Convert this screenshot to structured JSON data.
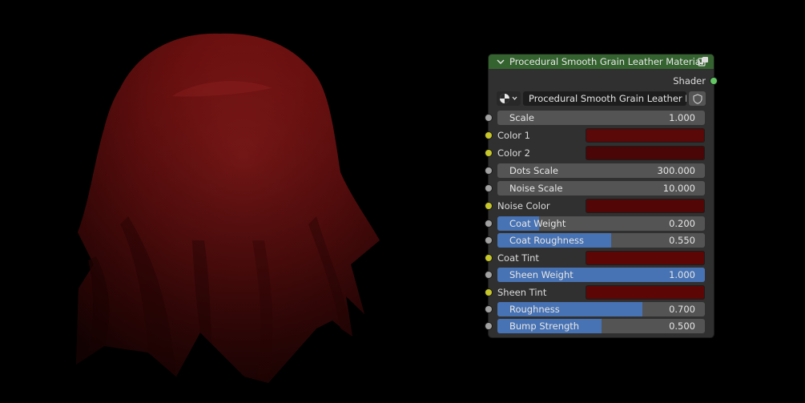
{
  "node": {
    "title": "Procedural Smooth Grain Leather Material",
    "output_label": "Shader",
    "selector": {
      "icon": "material-sphere-icon",
      "name": "Procedural Smooth Grain Leather M..."
    }
  },
  "inputs": {
    "scale": {
      "label": "Scale",
      "value": "1.000"
    },
    "color1": {
      "label": "Color 1",
      "color": "#5a0808"
    },
    "color2": {
      "label": "Color 2",
      "color": "#4a0606"
    },
    "dots_scale": {
      "label": "Dots Scale",
      "value": "300.000"
    },
    "noise_scale": {
      "label": "Noise Scale",
      "value": "10.000"
    },
    "noise_color": {
      "label": "Noise Color",
      "color": "#530606"
    },
    "coat_weight": {
      "label": "Coat Weight",
      "value": "0.200",
      "fill": 0.2
    },
    "coat_roughness": {
      "label": "Coat Roughness",
      "value": "0.550",
      "fill": 0.55
    },
    "coat_tint": {
      "label": "Coat Tint",
      "color": "#5d0606"
    },
    "sheen_weight": {
      "label": "Sheen Weight",
      "value": "1.000",
      "fill": 1.0
    },
    "sheen_tint": {
      "label": "Sheen Tint",
      "color": "#5d0606"
    },
    "roughness": {
      "label": "Roughness",
      "value": "0.700",
      "fill": 0.7
    },
    "bump_strength": {
      "label": "Bump Strength",
      "value": "0.500",
      "fill": 0.5
    }
  },
  "colors": {
    "header": "#34632f",
    "fill_blue": "#4772b3",
    "cloth": "#7a1414"
  }
}
